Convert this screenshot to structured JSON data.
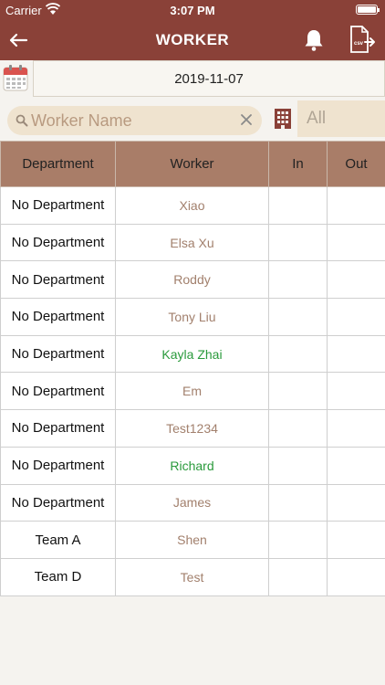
{
  "status_bar": {
    "carrier": "Carrier",
    "time": "3:07 PM"
  },
  "nav": {
    "title": "WORKER",
    "back_icon": "arrow-left-icon",
    "bell_icon": "bell-icon",
    "csv_icon": "csv-export-icon",
    "csv_label": "csv"
  },
  "date_picker": {
    "value": "2019-11-07",
    "icon": "calendar-icon"
  },
  "search": {
    "placeholder": "Worker Name",
    "value": ""
  },
  "filter": {
    "value": "All",
    "icon": "building-icon"
  },
  "colors": {
    "nav_bg": "#8a4138",
    "header_bg": "#a97d68",
    "worker_text": "#a2806d",
    "worker_highlight": "#2a9a3c"
  },
  "table": {
    "columns": [
      "Department",
      "Worker",
      "In",
      "Out"
    ],
    "rows": [
      {
        "department": "No Department",
        "worker": "Xiao",
        "in": "",
        "out": "",
        "highlight": false
      },
      {
        "department": "No Department",
        "worker": "Elsa Xu",
        "in": "",
        "out": "",
        "highlight": false
      },
      {
        "department": "No Department",
        "worker": "Roddy",
        "in": "",
        "out": "",
        "highlight": false
      },
      {
        "department": "No Department",
        "worker": "Tony Liu",
        "in": "",
        "out": "",
        "highlight": false
      },
      {
        "department": "No Department",
        "worker": "Kayla Zhai",
        "in": "",
        "out": "",
        "highlight": true
      },
      {
        "department": "No Department",
        "worker": "Em",
        "in": "",
        "out": "",
        "highlight": false
      },
      {
        "department": "No Department",
        "worker": "Test1234",
        "in": "",
        "out": "",
        "highlight": false
      },
      {
        "department": "No Department",
        "worker": "Richard",
        "in": "",
        "out": "",
        "highlight": true
      },
      {
        "department": "No Department",
        "worker": "James",
        "in": "",
        "out": "",
        "highlight": false
      },
      {
        "department": "Team A",
        "worker": "Shen",
        "in": "",
        "out": "",
        "highlight": false
      },
      {
        "department": "Team D",
        "worker": "Test",
        "in": "",
        "out": "",
        "highlight": false
      }
    ]
  }
}
